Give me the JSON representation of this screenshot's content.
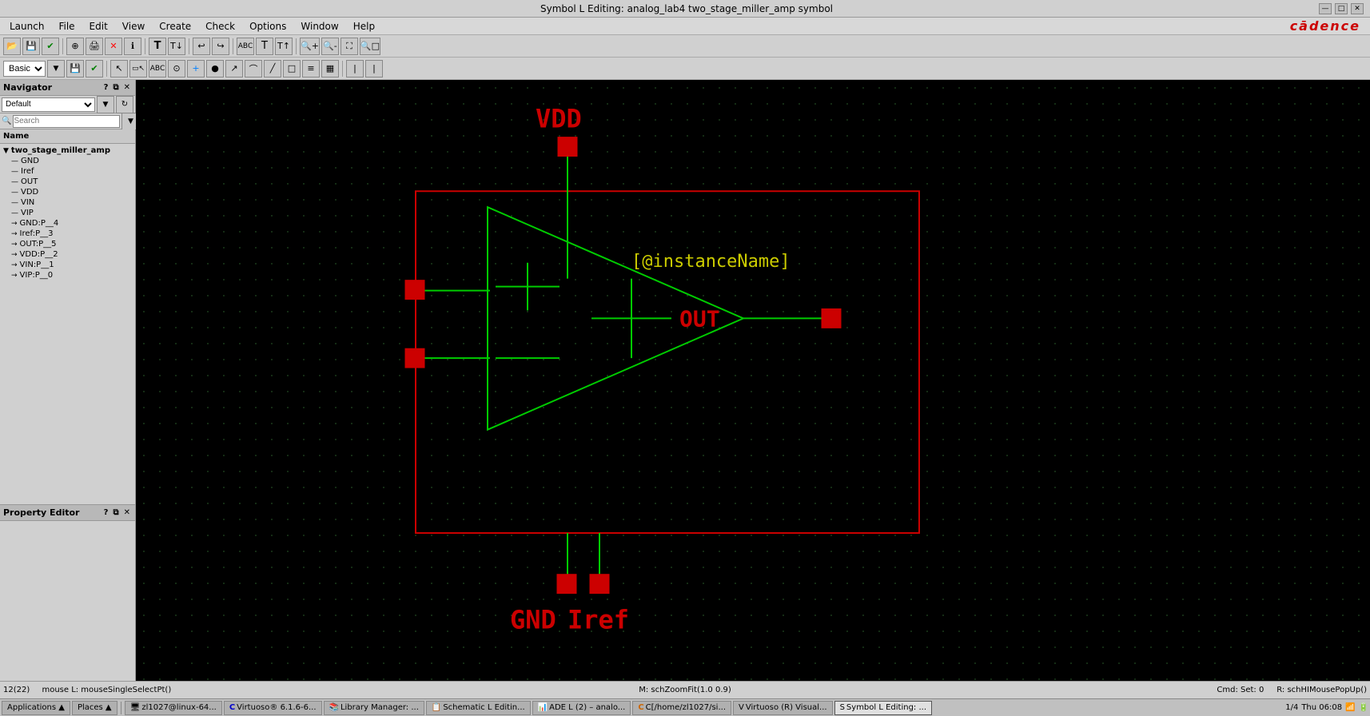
{
  "titlebar": {
    "title": "Symbol L Editing: analog_lab4 two_stage_miller_amp symbol",
    "controls": [
      "—",
      "□",
      "✕"
    ]
  },
  "menubar": {
    "items": [
      "Launch",
      "File",
      "Edit",
      "View",
      "Create",
      "Check",
      "Options",
      "Window",
      "Help"
    ],
    "brand": "cādence"
  },
  "toolbar1": {
    "buttons": [
      "📂",
      "💾",
      "✔",
      "⊕",
      "🖨",
      "✕",
      "ℹ",
      "T",
      "T↓",
      "|",
      "←",
      "ABC",
      "T",
      "T↑",
      "⊙",
      "+",
      "○",
      "↗",
      "⌒",
      "□",
      "≡",
      "▦"
    ]
  },
  "toolbar2": {
    "select_value": "Basic",
    "buttons": [
      "↖",
      "ABC",
      "⊙",
      "+",
      "○",
      "↗",
      "⌒",
      "□",
      "≡",
      "▦",
      "|",
      "|"
    ]
  },
  "navigator": {
    "title": "Navigator",
    "default_select": "Default",
    "search_placeholder": "Search",
    "col_name": "Name",
    "tree": [
      {
        "label": "two_stage_miller_amp",
        "level": 0,
        "icon": "▼"
      },
      {
        "label": "GND",
        "level": 1,
        "icon": "—"
      },
      {
        "label": "Iref",
        "level": 1,
        "icon": "—"
      },
      {
        "label": "OUT",
        "level": 1,
        "icon": "—"
      },
      {
        "label": "VDD",
        "level": 1,
        "icon": "—"
      },
      {
        "label": "VIN",
        "level": 1,
        "icon": "—"
      },
      {
        "label": "VIP",
        "level": 1,
        "icon": "—"
      },
      {
        "label": "GND:P__4",
        "level": 1,
        "icon": "→"
      },
      {
        "label": "Iref:P__3",
        "level": 1,
        "icon": "→"
      },
      {
        "label": "OUT:P__5",
        "level": 1,
        "icon": "→"
      },
      {
        "label": "VDD:P__2",
        "level": 1,
        "icon": "→"
      },
      {
        "label": "VIN:P__1",
        "level": 1,
        "icon": "→"
      },
      {
        "label": "VIP:P__0",
        "level": 1,
        "icon": "→"
      }
    ]
  },
  "property_editor": {
    "title": "Property Editor"
  },
  "canvas": {
    "vdd_label": "VDD",
    "gnd_label": "GND",
    "iref_label": "Iref",
    "out_label": "OUT",
    "instance_label": "[@instanceName]"
  },
  "statusbar": {
    "left": "mouse L: mouseSingleSelectPt()",
    "mid": "M: schZoomFit(1.0 0.9)",
    "right": "R: schHIMousePopUp()",
    "line": "12(22)",
    "cmd": "Cmd: Set: 0"
  },
  "taskbar": {
    "applications": "Applications ▲",
    "places": "Places ▲",
    "tasks": [
      {
        "label": "zl1027@linux-64...",
        "icon": "🖥"
      },
      {
        "label": "Virtuoso® 6.1.6-6...",
        "icon": "C"
      },
      {
        "label": "Library Manager: ...",
        "icon": "📚"
      },
      {
        "label": "Schematic L Editin...",
        "icon": "📋"
      },
      {
        "label": "ADE L (2) – analo...",
        "icon": "📊"
      },
      {
        "label": "C[/home/zl1027/si...",
        "icon": "C"
      },
      {
        "label": "Virtuoso (R) Visual...",
        "icon": "V"
      },
      {
        "label": "Symbol L Editing: ...",
        "icon": "S"
      }
    ],
    "page": "1/4",
    "time": "Thu 06:08",
    "wifi": "📶"
  }
}
